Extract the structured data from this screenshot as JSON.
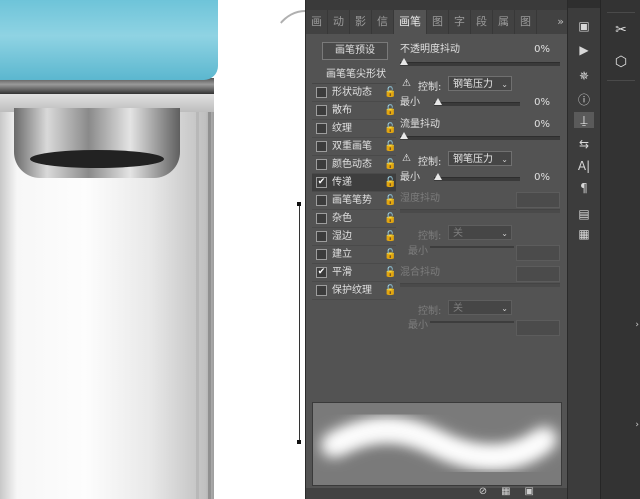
{
  "panel": {
    "tabs": [
      "画",
      "动",
      "影",
      "信",
      "画笔",
      "图",
      "字",
      "段",
      "属",
      "图"
    ],
    "active_tab_index": 4,
    "tabs_more": "»",
    "preset_button": "画笔预设",
    "sidebar_header": "画笔笔尖形状",
    "sidebar_items": [
      {
        "label": "形状动态",
        "checked": false,
        "check": ""
      },
      {
        "label": "散布",
        "checked": false,
        "check": ""
      },
      {
        "label": "纹理",
        "checked": false,
        "check": ""
      },
      {
        "label": "双重画笔",
        "checked": false,
        "check": ""
      },
      {
        "label": "颜色动态",
        "checked": false,
        "check": ""
      },
      {
        "label": "传递",
        "checked": true,
        "check": "✔"
      },
      {
        "label": "画笔笔势",
        "checked": false,
        "check": ""
      },
      {
        "label": "杂色",
        "checked": false,
        "check": ""
      },
      {
        "label": "湿边",
        "checked": false,
        "check": ""
      },
      {
        "label": "建立",
        "checked": false,
        "check": ""
      },
      {
        "label": "平滑",
        "checked": true,
        "check": "✔"
      },
      {
        "label": "保护纹理",
        "checked": false,
        "check": ""
      }
    ],
    "lock_glyph": "🔓",
    "opacity_jitter": {
      "label": "不透明度抖动",
      "value": "0%"
    },
    "opacity_control": {
      "warn": "⚠",
      "label": "控制:",
      "selected": "钢笔压力",
      "arrow": "⌄"
    },
    "opacity_min": {
      "label": "最小",
      "value": "0%"
    },
    "flow_jitter": {
      "label": "流量抖动",
      "value": "0%"
    },
    "flow_control": {
      "warn": "⚠",
      "label": "控制:",
      "selected": "钢笔压力",
      "arrow": "⌄"
    },
    "flow_min": {
      "label": "最小",
      "value": "0%"
    },
    "wetness_jitter": {
      "label": "湿度抖动"
    },
    "wetness_control": {
      "label": "控制:",
      "selected": "关",
      "arrow": "⌄"
    },
    "wetness_min": {
      "label": "最小"
    },
    "mix_jitter": {
      "label": "混合抖动"
    },
    "mix_control": {
      "label": "控制:",
      "selected": "关",
      "arrow": "⌄"
    },
    "mix_min": {
      "label": "最小"
    }
  },
  "tool_strip": [
    "▣",
    "▶",
    "✵",
    "ⓘ",
    "⍊",
    "⇆",
    "A|",
    "¶",
    "▤",
    "▦"
  ],
  "tool_strip_active_index": 4,
  "far_strip": [
    "✂",
    "⬡"
  ],
  "colors": {
    "cap": "#6ec4d9",
    "panel": "#535353",
    "strip": "#3c3c3c"
  }
}
